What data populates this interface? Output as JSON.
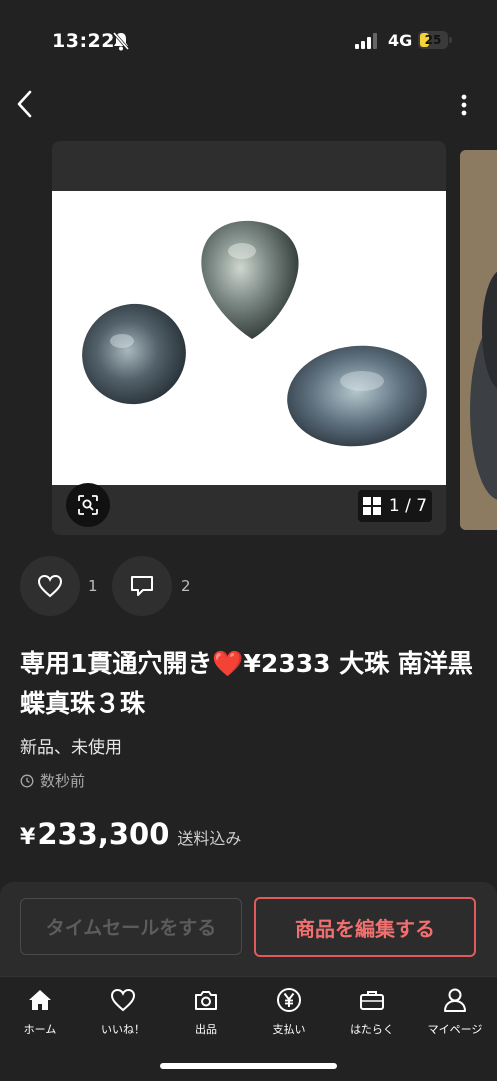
{
  "status_bar": {
    "time": "13:22",
    "network": "4G",
    "battery": "25"
  },
  "gallery": {
    "current": "1",
    "separator": "/",
    "total": "7"
  },
  "actions": {
    "like_count": "1",
    "comment_count": "2"
  },
  "product": {
    "title": "専用1貫通穴開き❤️¥2333 大珠 南洋黒蝶真珠３珠",
    "condition": "新品、未使用",
    "posted": "数秒前",
    "price_symbol": "¥",
    "price": "233,300",
    "shipping": "送料込み"
  },
  "buttons": {
    "timesale": "タイムセールをする",
    "edit": "商品を編集する"
  },
  "tabs": [
    {
      "label": "ホーム",
      "icon": "home-icon"
    },
    {
      "label": "いいね！",
      "icon": "heart-icon"
    },
    {
      "label": "出品",
      "icon": "camera-icon"
    },
    {
      "label": "支払い",
      "icon": "yen-icon"
    },
    {
      "label": "はたらく",
      "icon": "briefcase-icon"
    },
    {
      "label": "マイページ",
      "icon": "person-icon"
    }
  ],
  "colors": {
    "background": "#222222",
    "accent": "#e05a5a",
    "battery": "#f3d53a"
  }
}
